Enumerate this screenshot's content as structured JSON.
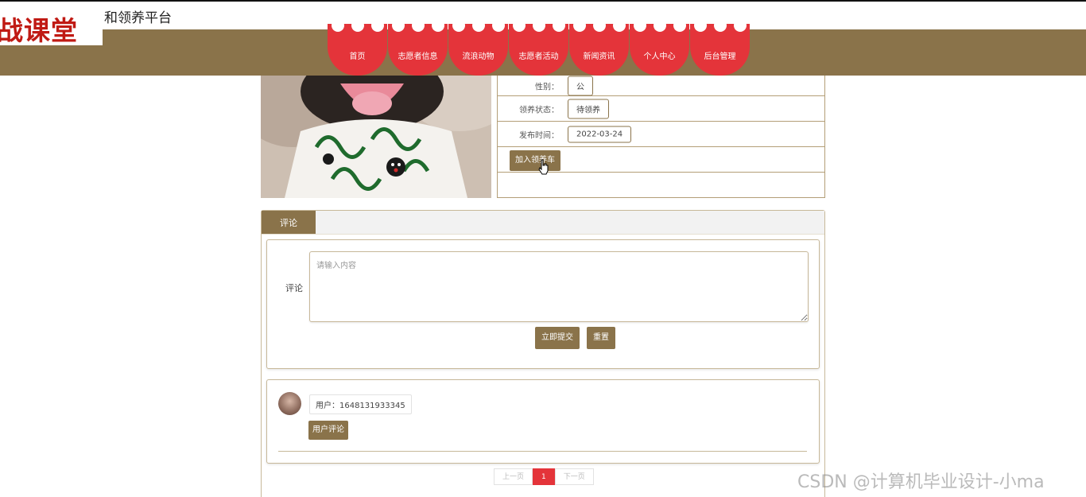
{
  "header": {
    "logo_text": "战课堂",
    "site_title": "和领养平台"
  },
  "nav": {
    "items": [
      {
        "label": "首页"
      },
      {
        "label": "志愿者信息"
      },
      {
        "label": "流浪动物"
      },
      {
        "label": "志愿者活动"
      },
      {
        "label": "新闻资讯"
      },
      {
        "label": "个人中心"
      },
      {
        "label": "后台管理"
      }
    ]
  },
  "detail": {
    "rows": [
      {
        "label": "性别：",
        "value": "公"
      },
      {
        "label": "领养状态：",
        "value": "待领养"
      },
      {
        "label": "发布时间：",
        "value": "2022-03-24"
      }
    ],
    "add_cart_label": "加入领养车"
  },
  "comments": {
    "tab_label": "评论",
    "form_label": "评论",
    "placeholder": "请输入内容",
    "submit_label": "立即提交",
    "reset_label": "重置",
    "items": [
      {
        "user": "用户：1648131933345",
        "content": "用户评论"
      }
    ]
  },
  "pagination": {
    "prev": "上一页",
    "current": "1",
    "next": "下一页"
  },
  "watermark": "CSDN @计算机毕业设计-小ma",
  "colors": {
    "brand_brown": "#8a734a",
    "nav_red": "#e4343a"
  }
}
